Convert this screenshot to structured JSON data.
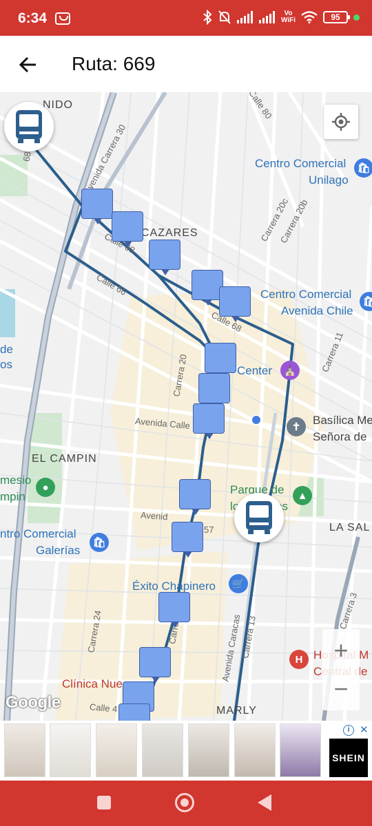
{
  "status_bar": {
    "time": "6:34",
    "battery": "95",
    "volte_line1": "Vo",
    "volte_line2": "WiFi",
    "colors": {
      "background": "#d1362f",
      "dot": "#4cd964"
    }
  },
  "header": {
    "back_icon": "arrow-left-icon",
    "title": "Ruta: 669"
  },
  "map": {
    "area_labels": {
      "cazares": "CAZARES",
      "el_campin": "EL CAMPIN",
      "la_sal": "LA SAL",
      "marly": "MARLY",
      "nido": "NIDO"
    },
    "streets": {
      "av_carrera_30": "Avenida Carrera 30",
      "calle_80": "Calle 80",
      "carrera_20c": "Carrera 20c",
      "carrera_20b": "Carrera 20b",
      "calle_68_a": "Calle 68",
      "calle_66": "Calle 66",
      "calle_68_b": "Calle 68",
      "carrera_11": "Carrera 11",
      "carrera_20": "Carrera 20",
      "av_calle_63": "Avenida Calle 6",
      "av_57": "Avenid",
      "num_57": "57",
      "carrera_24": "Carrera 24",
      "av_caracas": "Avenida Caracas",
      "carrera_13": "Carrera 13",
      "carrera_3": "Carrera 3",
      "calle_4": "Calle 4",
      "carre": "Carre",
      "num_68": "68"
    },
    "pois": {
      "cc_unilago_1": "Centro Comercial",
      "cc_unilago_2": "Unilago",
      "cc_chile_1": "Centro Comercial",
      "cc_chile_2": "Avenida Chile",
      "center": "Center",
      "basilica_1": "Basílica Me",
      "basilica_2": "Señora de",
      "parque_1": "Parque de",
      "parque_2": "lo",
      "parque_3": "es",
      "gimnasio_1": "mesio",
      "gimnasio_2": "mpin",
      "cc_galerias_1": "ntro Comercial",
      "cc_galerias_2": "Galerías",
      "exito": "Éxito Chapinero",
      "hospital_1": "Hospital M",
      "hospital_2": "Central de",
      "clinica": "Clínica Nue",
      "de": "de",
      "os": "os"
    },
    "google_logo": "Google",
    "zoom_in": "+",
    "zoom_out": "−",
    "route_color": "#2b5e8c",
    "stop_color": "#7aa3ee"
  },
  "ad": {
    "info": "i",
    "close": "✕",
    "brand": "SHEIN"
  },
  "nav_bar": {
    "recents_icon": "square-icon",
    "home_icon": "circle-icon",
    "back_icon": "triangle-back-icon"
  }
}
